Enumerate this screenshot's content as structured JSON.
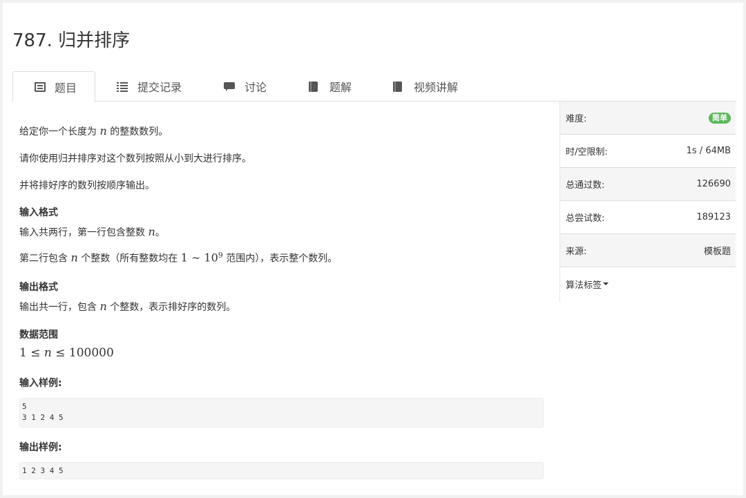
{
  "problem": {
    "title": "787. 归并排序"
  },
  "tabs": [
    {
      "label": "题目",
      "icon": "document-list-icon"
    },
    {
      "label": "提交记录",
      "icon": "list-icon"
    },
    {
      "label": "讨论",
      "icon": "comment-icon"
    },
    {
      "label": "题解",
      "icon": "book-icon"
    },
    {
      "label": "视频讲解",
      "icon": "book-icon"
    }
  ],
  "description": {
    "p1_a": "给定你一个长度为 ",
    "p1_var": "n",
    "p1_b": " 的整数数列。",
    "p2": "请你使用归并排序对这个数列按照从小到大进行排序。",
    "p3": "并将排好序的数列按顺序输出。",
    "input_heading": "输入格式",
    "input_a": "输入共两行，第一行包含整数 ",
    "input_var": "n",
    "input_b": "。",
    "input2_a": "第二行包含 ",
    "input2_var": "n",
    "input2_b": " 个整数（所有整数均在 ",
    "input2_math_lo": "1 ∼ 10",
    "input2_math_exp": "9",
    "input2_c": " 范围内），表示整个数列。",
    "output_heading": "输出格式",
    "output_a": "输出共一行，包含 ",
    "output_var": "n",
    "output_b": " 个整数，表示排好序的数列。",
    "range_heading": "数据范围",
    "range_a": "1 ≤ ",
    "range_var": "n",
    "range_b": " ≤ 100000",
    "sample_input_heading": "输入样例:",
    "sample_input": "5\n3 1 2 4 5",
    "sample_output_heading": "输出样例:",
    "sample_output": "1 2 3 4 5"
  },
  "sidebar": {
    "difficulty_label": "难度:",
    "difficulty_value": "简单",
    "limit_label": "时/空限制:",
    "limit_value": "1s / 64MB",
    "passed_label": "总通过数:",
    "passed_value": "126690",
    "attempts_label": "总尝试数:",
    "attempts_value": "189123",
    "source_label": "来源:",
    "source_value": "模板题",
    "tags_label": "算法标签"
  },
  "colors": {
    "badge": "#5cb85c"
  }
}
